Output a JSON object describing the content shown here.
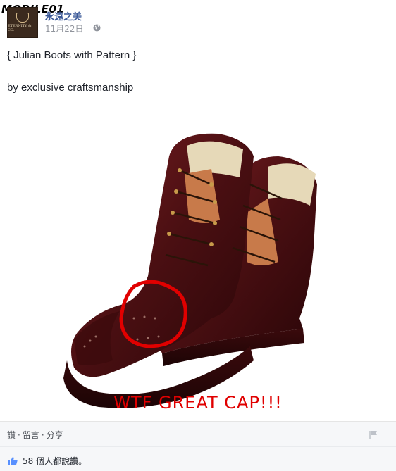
{
  "watermark": "MOBILE01",
  "post": {
    "page_name": "永遠之美",
    "date": "11月22日",
    "title_line": "{ Julian Boots with Pattern }",
    "subtitle_line": "by exclusive craftsmanship",
    "avatar_text": "ETERNITY & CO."
  },
  "photo": {
    "caption": "WTF GREAT CAP!!!",
    "colors": {
      "leather": "#5a1418",
      "circle": "#e00000"
    }
  },
  "actions": {
    "like": "讚",
    "comment": "留言",
    "share": "分享"
  },
  "likes": {
    "text": "58 個人都說讚。"
  }
}
